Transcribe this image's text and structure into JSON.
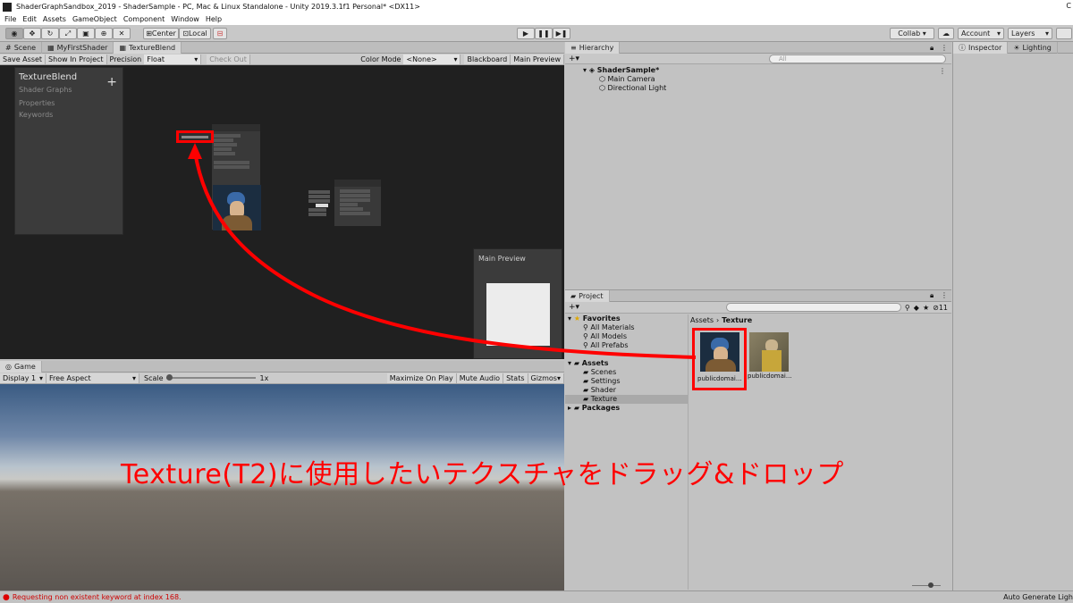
{
  "window": {
    "title": "ShaderGraphSandbox_2019 - ShaderSample - PC, Mac & Linux Standalone - Unity 2019.3.1f1 Personal* <DX11>",
    "edge_char": "C"
  },
  "menu": [
    "File",
    "Edit",
    "Assets",
    "GameObject",
    "Component",
    "Window",
    "Help"
  ],
  "toolbar": {
    "center": "Center",
    "local": "Local",
    "collab": "Collab ▾",
    "account": "Account",
    "layers": "Layers"
  },
  "scene_tabs": {
    "scene": "Scene",
    "myfirstshader": "MyFirstShader",
    "textureblend": "TextureBlend"
  },
  "graph_toolbar": {
    "save_asset": "Save Asset",
    "show_in_project": "Show In Project",
    "precision_label": "Precision",
    "precision_value": "Float",
    "check_out": "Check Out",
    "color_mode_label": "Color Mode",
    "color_mode_value": "<None>",
    "blackboard": "Blackboard",
    "main_preview": "Main Preview"
  },
  "blackboard": {
    "title": "TextureBlend",
    "subtitle": "Shader Graphs",
    "properties": "Properties",
    "keywords": "Keywords",
    "add": "+"
  },
  "preview": {
    "title": "Main Preview"
  },
  "game": {
    "tab": "Game",
    "display": "Display 1",
    "aspect": "Free Aspect",
    "scale_label": "Scale",
    "scale_value": "1x",
    "maximize": "Maximize On Play",
    "mute": "Mute Audio",
    "stats": "Stats",
    "gizmos": "Gizmos"
  },
  "hierarchy": {
    "tab": "Hierarchy",
    "search_placeholder": "All",
    "scene": "ShaderSample*",
    "items": [
      "Main Camera",
      "Directional Light"
    ]
  },
  "inspector": {
    "tab": "Inspector",
    "lighting": "Lighting"
  },
  "project": {
    "tab": "Project",
    "favorites": "Favorites",
    "fav_items": [
      "All Materials",
      "All Models",
      "All Prefabs"
    ],
    "assets": "Assets",
    "asset_items": [
      "Scenes",
      "Settings",
      "Shader",
      "Texture"
    ],
    "packages": "Packages",
    "breadcrumb_root": "Assets",
    "breadcrumb_current": "Texture",
    "hidden_count": "11",
    "files": [
      "publicdomai...",
      "publicdomai..."
    ]
  },
  "status": {
    "message": "Requesting non existent keyword at index 168.",
    "right": "Auto Generate Ligh"
  },
  "annotation": {
    "text": "Texture(T2)に使用したいテクスチャをドラッグ&ドロップ",
    "color": "#ff0000"
  }
}
